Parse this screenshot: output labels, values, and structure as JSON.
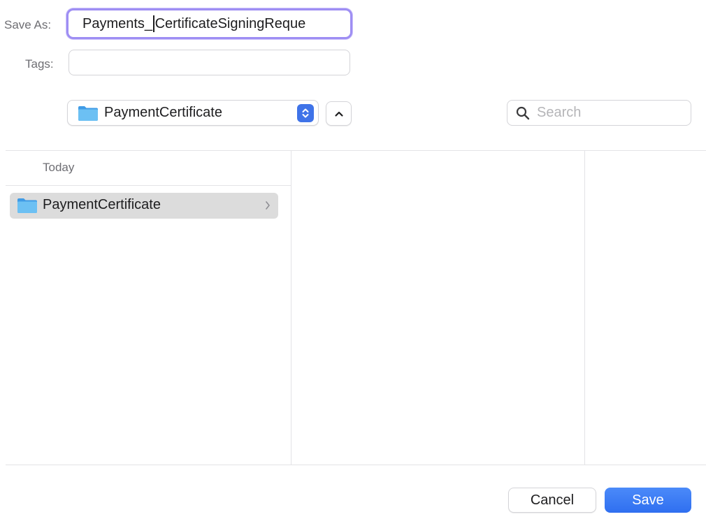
{
  "save_as": {
    "label": "Save As:",
    "value_before_caret": "Payments_",
    "value_after_caret": "CertificateSigningReque"
  },
  "tags": {
    "label": "Tags:",
    "value": ""
  },
  "location": {
    "folder": "PaymentCertificate"
  },
  "search": {
    "placeholder": "Search",
    "value": ""
  },
  "browser": {
    "section": "Today",
    "items": [
      {
        "label": "PaymentCertificate"
      }
    ]
  },
  "buttons": {
    "cancel": "Cancel",
    "save": "Save"
  },
  "colors": {
    "accent": "#3478f6",
    "focus_ring": "#9e8ef3",
    "folder": "#5eb6f0",
    "selected_row": "#dcdcdc"
  }
}
